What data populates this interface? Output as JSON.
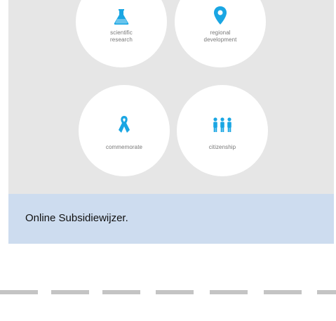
{
  "colors": {
    "panel_bg": "#e6e6e6",
    "icon_accent": "#1aa6e3",
    "caption_bg": "#cddcef",
    "dash": "#c4c4c4"
  },
  "categories": [
    {
      "icon": "flask-icon",
      "line1": "scientific",
      "line2": "research"
    },
    {
      "icon": "map-pin-icon",
      "line1": "regional",
      "line2": "development"
    },
    {
      "icon": "ribbon-icon",
      "line1": "commemorate",
      "line2": ""
    },
    {
      "icon": "people-icon",
      "line1": "citizenship",
      "line2": ""
    }
  ],
  "caption": {
    "text": "Online Subsidiewijzer."
  }
}
